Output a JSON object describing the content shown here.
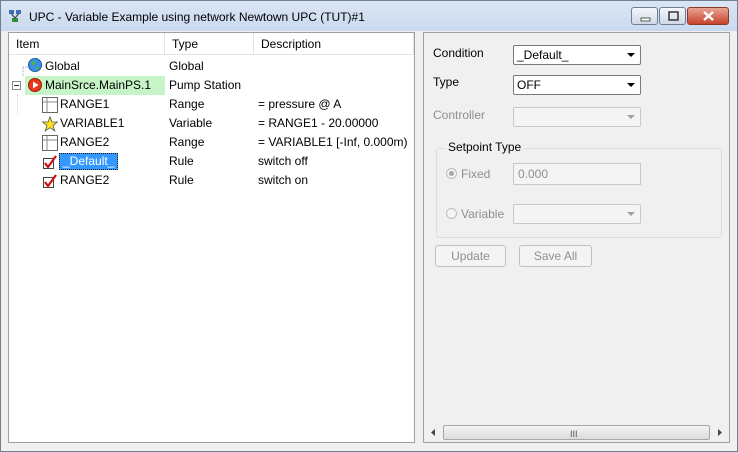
{
  "window": {
    "title": "UPC - Variable Example using network Newtown UPC (TUT)#1",
    "icon": "network-icon",
    "controls": [
      "minimize-icon",
      "maximize-icon",
      "close-icon"
    ]
  },
  "tree": {
    "columns": [
      "Item",
      "Type",
      "Description"
    ],
    "rows": [
      {
        "item": "Global",
        "type": "Global",
        "description": "",
        "icon": "globe-icon"
      },
      {
        "item": "MainSrce.MainPS.1",
        "type": "Pump Station",
        "description": "",
        "icon": "pump-station-icon",
        "highlight": "#c6f4c6"
      },
      {
        "item": "RANGE1",
        "type": "Range",
        "description": "= pressure @ A",
        "icon": "range-icon"
      },
      {
        "item": "VARIABLE1",
        "type": "Variable",
        "description": "= RANGE1 - 20.00000",
        "icon": "star-icon"
      },
      {
        "item": "RANGE2",
        "type": "Range",
        "description": "= VARIABLE1 [-Inf, 0.000m)",
        "icon": "range-icon"
      },
      {
        "item": "_Default_",
        "type": "Rule",
        "description": "switch off",
        "icon": "rule-check-icon",
        "selected": true
      },
      {
        "item": "RANGE2",
        "type": "Rule",
        "description": "switch on",
        "icon": "rule-check-icon"
      }
    ]
  },
  "properties": {
    "condition_label": "Condition",
    "condition_value": "_Default_",
    "type_label": "Type",
    "type_value": "OFF",
    "controller_label": "Controller",
    "controller_value": "",
    "setpoint_title": "Setpoint Type",
    "fixed_label": "Fixed",
    "fixed_value": "0.000",
    "variable_label": "Variable",
    "variable_value": "",
    "update_label": "Update",
    "save_all_label": "Save All",
    "scrollbar_grip": "III"
  },
  "colors": {
    "selection": "#3399ff",
    "pump_highlight": "#c6f4c6",
    "titlebar": "#c9d9ee",
    "disabled_text": "#8f8f8f"
  }
}
